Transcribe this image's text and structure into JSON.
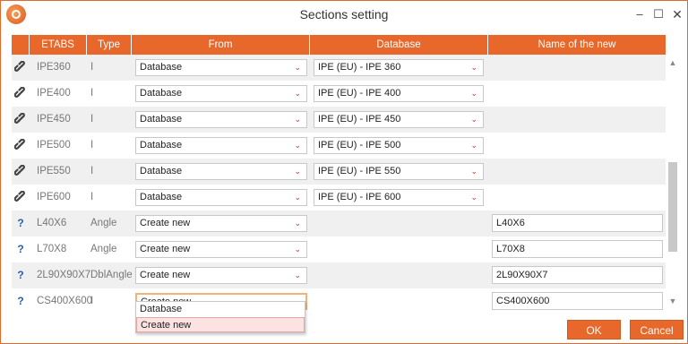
{
  "window": {
    "title": "Sections setting"
  },
  "colors": {
    "accent": "#e8672a",
    "question": "#2a5fa8"
  },
  "columns": [
    "ETABS",
    "Type",
    "From",
    "Database",
    "Name of the new"
  ],
  "rows": [
    {
      "icon": "link-icon",
      "etabs": "IPE360",
      "type": "I",
      "from": "Database",
      "database": "IPE (EU) - IPE 360",
      "name": ""
    },
    {
      "icon": "link-icon",
      "etabs": "IPE400",
      "type": "I",
      "from": "Database",
      "database": "IPE (EU) - IPE 400",
      "name": ""
    },
    {
      "icon": "link-icon",
      "etabs": "IPE450",
      "type": "I",
      "from": "Database",
      "database": "IPE (EU) - IPE 450",
      "name": ""
    },
    {
      "icon": "link-icon",
      "etabs": "IPE500",
      "type": "I",
      "from": "Database",
      "database": "IPE (EU) - IPE 500",
      "name": ""
    },
    {
      "icon": "link-icon",
      "etabs": "IPE550",
      "type": "I",
      "from": "Database",
      "database": "IPE (EU) - IPE 550",
      "name": ""
    },
    {
      "icon": "link-icon",
      "etabs": "IPE600",
      "type": "I",
      "from": "Database",
      "database": "IPE (EU) - IPE 600",
      "name": ""
    },
    {
      "icon": "question-icon",
      "etabs": "L40X6",
      "type": "Angle",
      "from": "Create new",
      "database": "",
      "name": "L40X6"
    },
    {
      "icon": "question-icon",
      "etabs": "L70X8",
      "type": "Angle",
      "from": "Create new",
      "database": "",
      "name": "L70X8"
    },
    {
      "icon": "question-icon",
      "etabs": "2L90X90X7",
      "type": "DblAngle",
      "from": "Create new",
      "database": "",
      "name": "2L90X90X7"
    },
    {
      "icon": "question-icon",
      "etabs": "CS400X600",
      "type": "I",
      "from": "Create new",
      "database": "",
      "name": "CS400X600"
    }
  ],
  "dropdown": {
    "options": [
      "Database",
      "Create new"
    ],
    "selected": "Create new"
  },
  "buttons": {
    "ok": "OK",
    "cancel": "Cancel"
  },
  "glyphs": {
    "question": "?",
    "chevron": "⌄",
    "minimize": "–",
    "maximize": "☐",
    "close": "✕",
    "scroll_up": "▲",
    "scroll_down": "▼"
  }
}
